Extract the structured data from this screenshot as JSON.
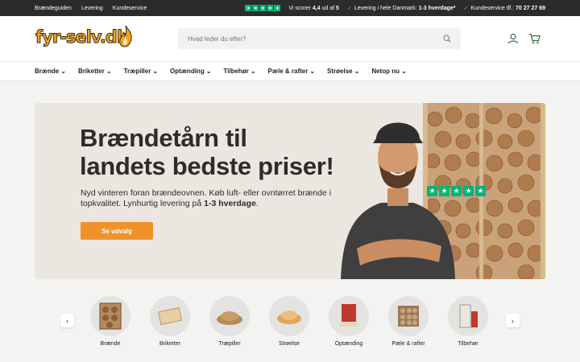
{
  "topbar": {
    "links": [
      "Brændeguiden",
      "Levering",
      "Kundeservice"
    ],
    "rating_text_pre": "Vi scorer ",
    "rating_value": "4,4",
    "rating_text_mid": " ud af ",
    "rating_max": "5",
    "delivery_pre": "Levering i hele Danmark: ",
    "delivery_bold": "1-3 hverdage*",
    "service_pre": "Kundeservice tlf.: ",
    "service_phone": "70 27 27 69"
  },
  "header": {
    "logo_text": "fyr-selv.dk",
    "search_placeholder": "Hvad leder du efter?"
  },
  "nav": [
    "Brænde",
    "Briketter",
    "Træpiller",
    "Optænding",
    "Tilbehør",
    "Pæle & rafter",
    "Strøelse",
    "Netop nu"
  ],
  "hero": {
    "title_line1": "Brændetårn til",
    "title_line2": "landets bedste priser!",
    "text_pre": "Nyd vinteren foran brændeovnen. Køb luft- eller ovntørret brænde i topkvalitet. Lynhurtig levering på ",
    "text_bold": "1-3 hverdage",
    "text_post": ".",
    "cta": "Se udvalg"
  },
  "categories": [
    "Brænde",
    "Briketter",
    "Træpiller",
    "Strøelse",
    "Optænding",
    "Pæle & rafter",
    "Tilbehør"
  ],
  "colors": {
    "accent": "#f0922c",
    "trustpilot": "#00b67a",
    "topbar": "#2b2b2b"
  }
}
